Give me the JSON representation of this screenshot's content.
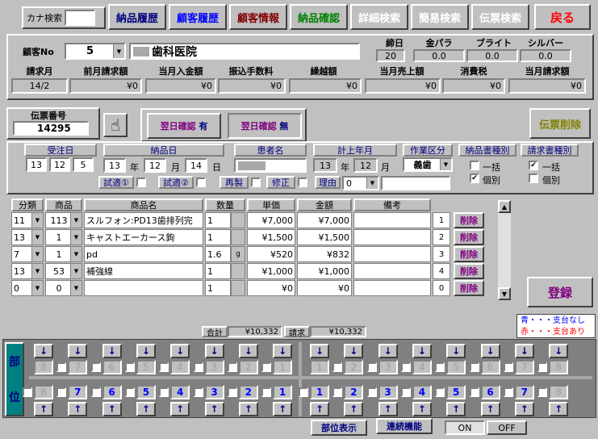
{
  "top": {
    "kana_search_label": "カナ検索",
    "kana_search_value": "",
    "tabs": [
      "納品履歴",
      "顧客履歴",
      "顧客情報",
      "納品確認",
      "詳細検索",
      "簡易検索",
      "伝票検索"
    ],
    "tab_colors": [
      "#000080",
      "#0000ff",
      "#800000",
      "#008000",
      "#ffffff",
      "#ffffff",
      "#ffffff"
    ],
    "back_label": "戻る"
  },
  "customer": {
    "no_label": "顧客No",
    "no_value": "5",
    "name_value": "歯科医院",
    "shime_label": "締日",
    "shime_value": "20",
    "kin_label": "金パラ",
    "kin_value": "0.0",
    "bright_label": "ブライト",
    "bright_value": "0.0",
    "silver_label": "シルバー",
    "silver_value": "0.0",
    "headers": [
      "請求月",
      "前月請求額",
      "当月入金額",
      "振込手数料",
      "繰越額",
      "当月売上額",
      "消費税",
      "当月請求額"
    ],
    "values": [
      "14/2",
      "¥0",
      "¥0",
      "¥0",
      "¥0",
      "¥0",
      "¥0",
      "¥0"
    ]
  },
  "slip": {
    "label": "伝票番号",
    "value": "14295",
    "hand_icon": "☝",
    "confirm1_label": "翌日確認",
    "confirm1_value": "有",
    "confirm2_label": "翌日確認",
    "confirm2_value": "無",
    "delete_label": "伝票削除"
  },
  "order": {
    "order_date_label": "受注日",
    "order_y": "13",
    "order_m": "12",
    "order_d": "5",
    "delivery_label": "納品日",
    "del_y": "13",
    "del_m": "12",
    "del_d": "14",
    "year_unit": "年",
    "month_unit": "月",
    "day_unit": "日",
    "patient_label": "患者名",
    "patient_value": "",
    "posting_label": "計上年月",
    "post_y": "13",
    "post_m": "12",
    "work_label": "作業区分",
    "work_value": "義歯",
    "nouhin_kind_label": "納品書種別",
    "seikyu_kind_label": "請求書種別",
    "ikkatsu": "一括",
    "kobetsu": "個別",
    "trial1": "試適①",
    "trial2": "試適②",
    "remake": "再製",
    "fix": "修正",
    "reason_label": "理由",
    "reason_value": "0"
  },
  "grid": {
    "headers": [
      "分類",
      "商品",
      "商品名",
      "数量",
      "単価",
      "金額",
      "備考"
    ],
    "rows": [
      {
        "cat": "11",
        "prod": "113",
        "name": "スルフォン:PD13歯排列完",
        "qty": "1",
        "unit": "",
        "price": "¥7,000",
        "amount": "¥7,000",
        "note": "",
        "no": "1"
      },
      {
        "cat": "13",
        "prod": "1",
        "name": "キャストエーカース鉤",
        "qty": "1",
        "unit": "",
        "price": "¥1,500",
        "amount": "¥1,500",
        "note": "",
        "no": "2"
      },
      {
        "cat": "7",
        "prod": "1",
        "name": "pd",
        "qty": "1.6",
        "unit": "g",
        "price": "¥520",
        "amount": "¥832",
        "note": "",
        "no": "3"
      },
      {
        "cat": "13",
        "prod": "53",
        "name": "補強線",
        "qty": "1",
        "unit": "",
        "price": "¥1,000",
        "amount": "¥1,000",
        "note": "",
        "no": "4"
      },
      {
        "cat": "0",
        "prod": "0",
        "name": "",
        "qty": "1",
        "unit": "",
        "price": "¥0",
        "amount": "¥0",
        "note": "",
        "no": "0"
      }
    ],
    "delete_label": "削除",
    "total_label": "合計",
    "total_value": "¥10,332",
    "seikyu_label": "請求",
    "seikyu_value": "¥10,332"
  },
  "register_label": "登録",
  "legend": {
    "blue": "青・・・支台なし",
    "red": "赤・・・支台あり"
  },
  "teeth": {
    "label_top": "部",
    "label_bottom": "位",
    "upper": [
      "8",
      "7",
      "6",
      "5",
      "4",
      "3",
      "2",
      "1",
      "1",
      "2",
      "3",
      "4",
      "5",
      "6",
      "7",
      "8"
    ],
    "lower": [
      "8",
      "7",
      "6",
      "5",
      "4",
      "3",
      "2",
      "1",
      "1",
      "2",
      "3",
      "4",
      "5",
      "6",
      "7",
      "8"
    ],
    "down_arrow": "↓",
    "up_arrow": "↑"
  },
  "bottom": {
    "show_label": "部位表示",
    "continuous_label": "連続機能",
    "on_label": "ON",
    "off_label": "OFF"
  }
}
